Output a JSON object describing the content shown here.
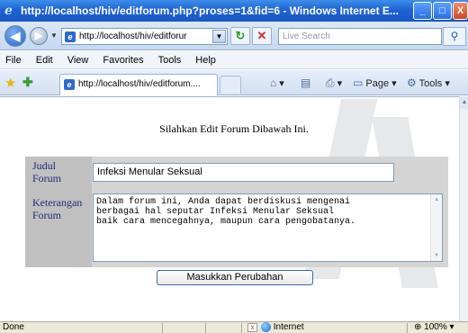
{
  "window": {
    "title": "http://localhost/hiv/editforum.php?proses=1&fid=6 - Windows Internet E...",
    "minimize_label": "_",
    "maximize_label": "□",
    "close_label": "X"
  },
  "address": {
    "url": "http://localhost/hiv/editforur",
    "search_placeholder": "Live Search"
  },
  "menu": [
    "File",
    "Edit",
    "View",
    "Favorites",
    "Tools",
    "Help"
  ],
  "tab": {
    "label": "http://localhost/hiv/editforum...."
  },
  "commands": {
    "page_label": "Page",
    "tools_label": "Tools"
  },
  "form": {
    "title": "Silahkan Edit Forum Dibawah Ini.",
    "judul_label_line1": "Judul",
    "judul_label_line2": "Forum",
    "judul_value": "Infeksi Menular Seksual",
    "keterangan_label_line1": "Keterangan",
    "keterangan_label_line2": "Forum",
    "keterangan_value": "Dalam forum ini, Anda dapat berdiskusi mengenai\nberbagai hal seputar Infeksi Menular Seksual\nbaik cara mencegahnya, maupun cara pengobatanya.",
    "submit_label": "Masukkan Perubahan"
  },
  "status": {
    "text": "Done",
    "zone": "Internet",
    "zoom": "100%"
  }
}
